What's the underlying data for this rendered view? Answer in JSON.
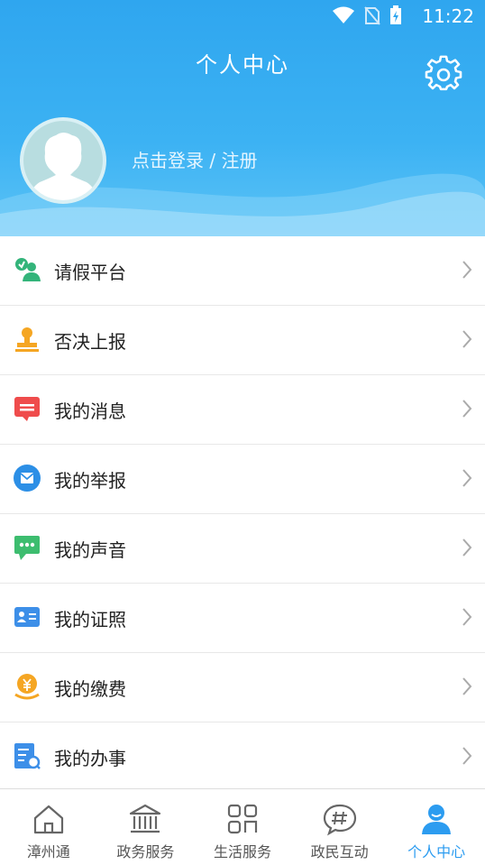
{
  "status": {
    "time": "11:22"
  },
  "header": {
    "title": "个人中心",
    "login_text": "点击登录 / 注册"
  },
  "menu": [
    {
      "label": "请假平台",
      "icon": "leave-icon"
    },
    {
      "label": "否决上报",
      "icon": "stamp-icon"
    },
    {
      "label": "我的消息",
      "icon": "message-icon"
    },
    {
      "label": "我的举报",
      "icon": "report-icon"
    },
    {
      "label": "我的声音",
      "icon": "voice-icon"
    },
    {
      "label": "我的证照",
      "icon": "license-icon"
    },
    {
      "label": "我的缴费",
      "icon": "payment-icon"
    },
    {
      "label": "我的办事",
      "icon": "affairs-icon"
    }
  ],
  "tabs": [
    {
      "label": "漳州通",
      "icon": "home-icon"
    },
    {
      "label": "政务服务",
      "icon": "government-icon"
    },
    {
      "label": "生活服务",
      "icon": "grid-icon"
    },
    {
      "label": "政民互动",
      "icon": "hashtag-chat-icon"
    },
    {
      "label": "个人中心",
      "icon": "person-icon"
    }
  ],
  "colors": {
    "accent": "#2c9cf0",
    "header_top": "#2fa6ef",
    "header_bottom": "#5cc3f6"
  }
}
